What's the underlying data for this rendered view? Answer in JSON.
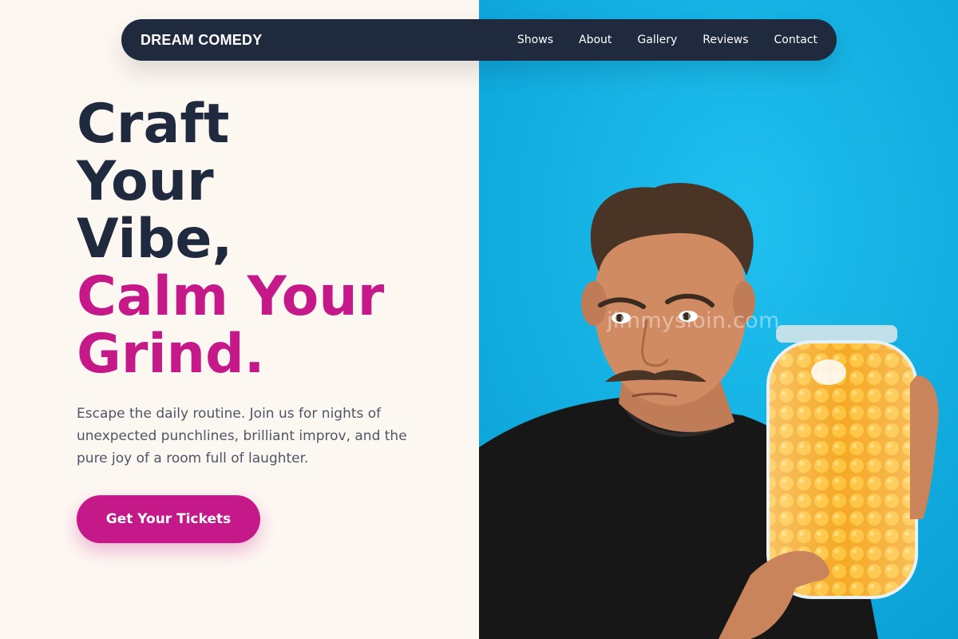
{
  "nav": {
    "brand": "DREAM COMEDY",
    "links": [
      "Shows",
      "About",
      "Gallery",
      "Reviews",
      "Contact"
    ]
  },
  "hero": {
    "title_dark_lines": [
      "Craft",
      "Your",
      "Vibe,"
    ],
    "title_accent_lines": [
      "Calm Your",
      "Grind."
    ],
    "description": "Escape the daily routine. Join us for nights of unexpected punchlines, brilliant improv, and the pure joy of a room full of laughter.",
    "cta_label": "Get Your Tickets"
  },
  "photo": {
    "watermark": "jimmysloin.com"
  },
  "colors": {
    "navy": "#1f2a3f",
    "accent": "#c5198a",
    "cream": "#fdf7f2",
    "sky_blue": "#0fb0e3"
  }
}
